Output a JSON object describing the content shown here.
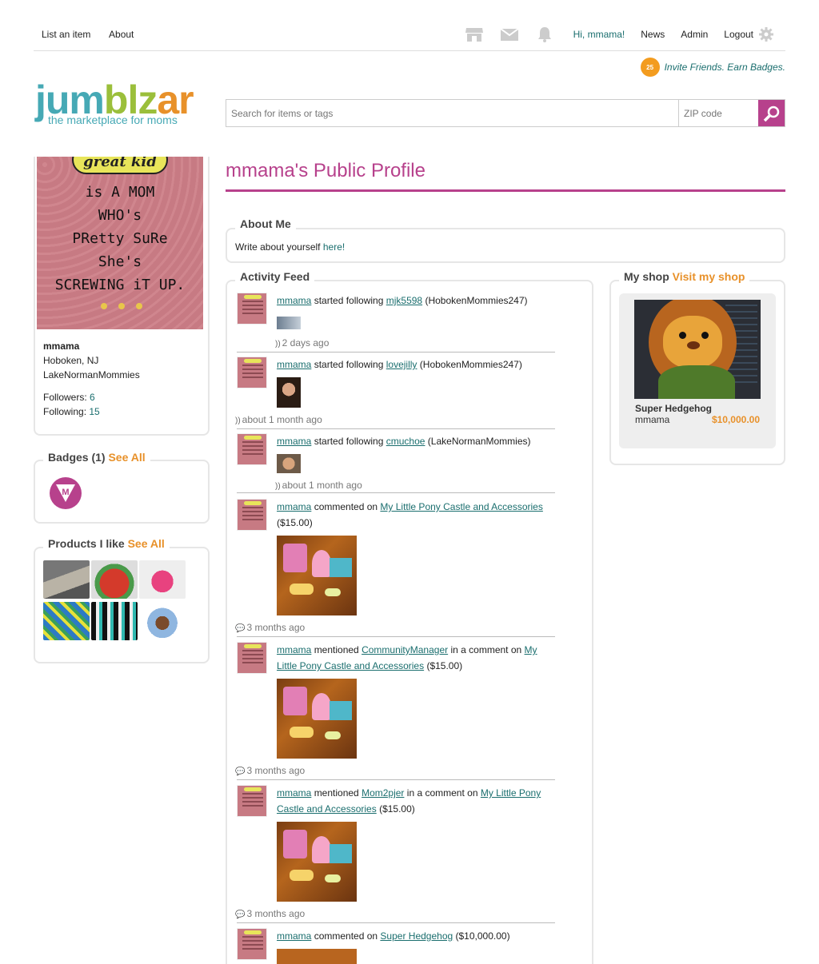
{
  "nav": {
    "list_item": "List an item",
    "about": "About",
    "greeting": "Hi, mmama!",
    "news": "News",
    "admin": "Admin",
    "logout": "Logout",
    "icons": [
      "shop-icon",
      "mail-icon",
      "bell-icon",
      "gear-icon"
    ]
  },
  "invite": {
    "coin": "25",
    "text": "Invite Friends. Earn Badges."
  },
  "logo": {
    "word_jum": "jum",
    "word_blz": "blz",
    "word_ar": "ar",
    "tagline": "the marketplace for moms"
  },
  "search": {
    "query_placeholder": "Search for items or tags",
    "zip_placeholder": "ZIP code"
  },
  "profile": {
    "image_bubble": "great kid",
    "image_quote": "is A MOM\nWHO's\nPRetty SuRe\nShe's\nSCREWING iT UP.",
    "username": "mmama",
    "location": "Hoboken, NJ",
    "group": "LakeNormanMommies",
    "followers_label": "Followers:",
    "followers": "6",
    "following_label": "Following:",
    "following": "15"
  },
  "badges": {
    "title": "Badges (1)",
    "see_all": "See All"
  },
  "products": {
    "title": "Products I like",
    "see_all": "See All"
  },
  "main": {
    "page_title": "mmama's Public Profile",
    "about_title": "About Me",
    "about_prompt": "Write about yourself",
    "about_link": "here!",
    "feed_title": "Activity Feed",
    "shop_title": "My shop",
    "shop_link": "Visit my shop"
  },
  "feed": [
    {
      "user": "mmama",
      "action": "started following",
      "target": "mjk5598",
      "extra": "(HobokenMommies247)",
      "time": "2 days ago"
    },
    {
      "user": "mmama",
      "action": "started following",
      "target": "lovejilly",
      "extra": "(HobokenMommies247)",
      "time": "about 1 month ago"
    },
    {
      "user": "mmama",
      "action": "started following",
      "target": "cmuchoe",
      "extra": "(LakeNormanMommies)",
      "time": "about 1 month ago"
    },
    {
      "user": "mmama",
      "action": "commented on",
      "target": "My Little Pony Castle and Accessories",
      "extra": "($15.00)",
      "time": "3 months ago"
    },
    {
      "user": "mmama",
      "action": "mentioned",
      "mention": "CommunityManager",
      "action2": "in a comment on",
      "target": "My Little Pony Castle and Accessories",
      "extra": "($15.00)",
      "time": "3 months ago"
    },
    {
      "user": "mmama",
      "action": "mentioned",
      "mention": "Mom2pjer",
      "action2": "in a comment on",
      "target": "My Little Pony Castle and Accessories",
      "extra": "($15.00)",
      "time": "3 months ago"
    },
    {
      "user": "mmama",
      "action": "commented on",
      "target": "Super Hedgehog",
      "extra": "($10,000.00)"
    }
  ],
  "shop": {
    "item_name": "Super Hedgehog",
    "seller": "mmama",
    "price": "$10,000.00"
  },
  "colors": {
    "brand_pink": "#b7418c",
    "teal_link": "#1a6e6e",
    "orange": "#e8912a"
  }
}
